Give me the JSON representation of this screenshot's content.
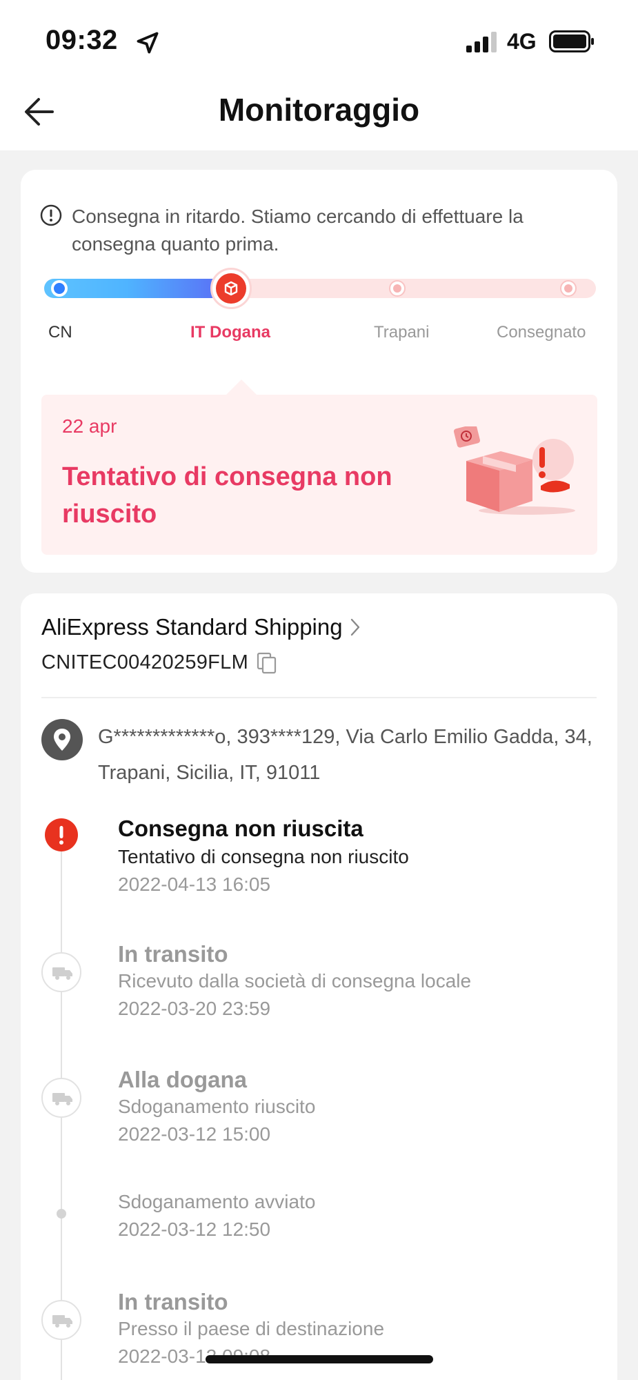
{
  "status_bar": {
    "time": "09:32",
    "network": "4G"
  },
  "nav": {
    "title": "Monitoraggio"
  },
  "alert": {
    "text": "Consegna in ritardo. Stiamo cercando di effettuare la consegna quanto prima."
  },
  "progress": {
    "steps": [
      {
        "label": "CN",
        "state": "done"
      },
      {
        "label": "IT Dogana",
        "state": "current"
      },
      {
        "label": "Trapani",
        "state": "pending"
      },
      {
        "label": "Consegnato",
        "state": "pending"
      }
    ]
  },
  "status_panel": {
    "date": "22 apr",
    "title": "Tentativo di consegna non riuscito"
  },
  "shipping": {
    "carrier": "AliExpress Standard Shipping",
    "tracking_number": "CNITEC00420259FLM"
  },
  "address": {
    "text": "G*************o,  393****129,  Via Carlo Emilio Gadda, 34,  Trapani,  Sicilia,  IT,  91011"
  },
  "events": [
    {
      "title": "Consegna non riuscita",
      "desc": "Tentativo di consegna non riuscito",
      "time": "2022-04-13 16:05",
      "marker": "alert-icon"
    },
    {
      "title": "In transito",
      "desc": "Ricevuto dalla società di consegna locale",
      "time": "2022-03-20 23:59",
      "marker": "truck-icon"
    },
    {
      "title": "Alla dogana",
      "desc": "Sdoganamento riuscito",
      "time": "2022-03-12 15:00",
      "marker": "truck-icon"
    },
    {
      "title": "",
      "desc": "Sdoganamento avviato",
      "time": "2022-03-12 12:50",
      "marker": "dot"
    },
    {
      "title": "In transito",
      "desc": "Presso il paese di destinazione",
      "time": "2022-03-12 09:08",
      "marker": "truck-icon"
    }
  ],
  "colors": {
    "accent": "#e83a63",
    "alert_red": "#e8321f",
    "progress_blue": "#4fb4ff",
    "panel_bg": "#fff1f1"
  }
}
